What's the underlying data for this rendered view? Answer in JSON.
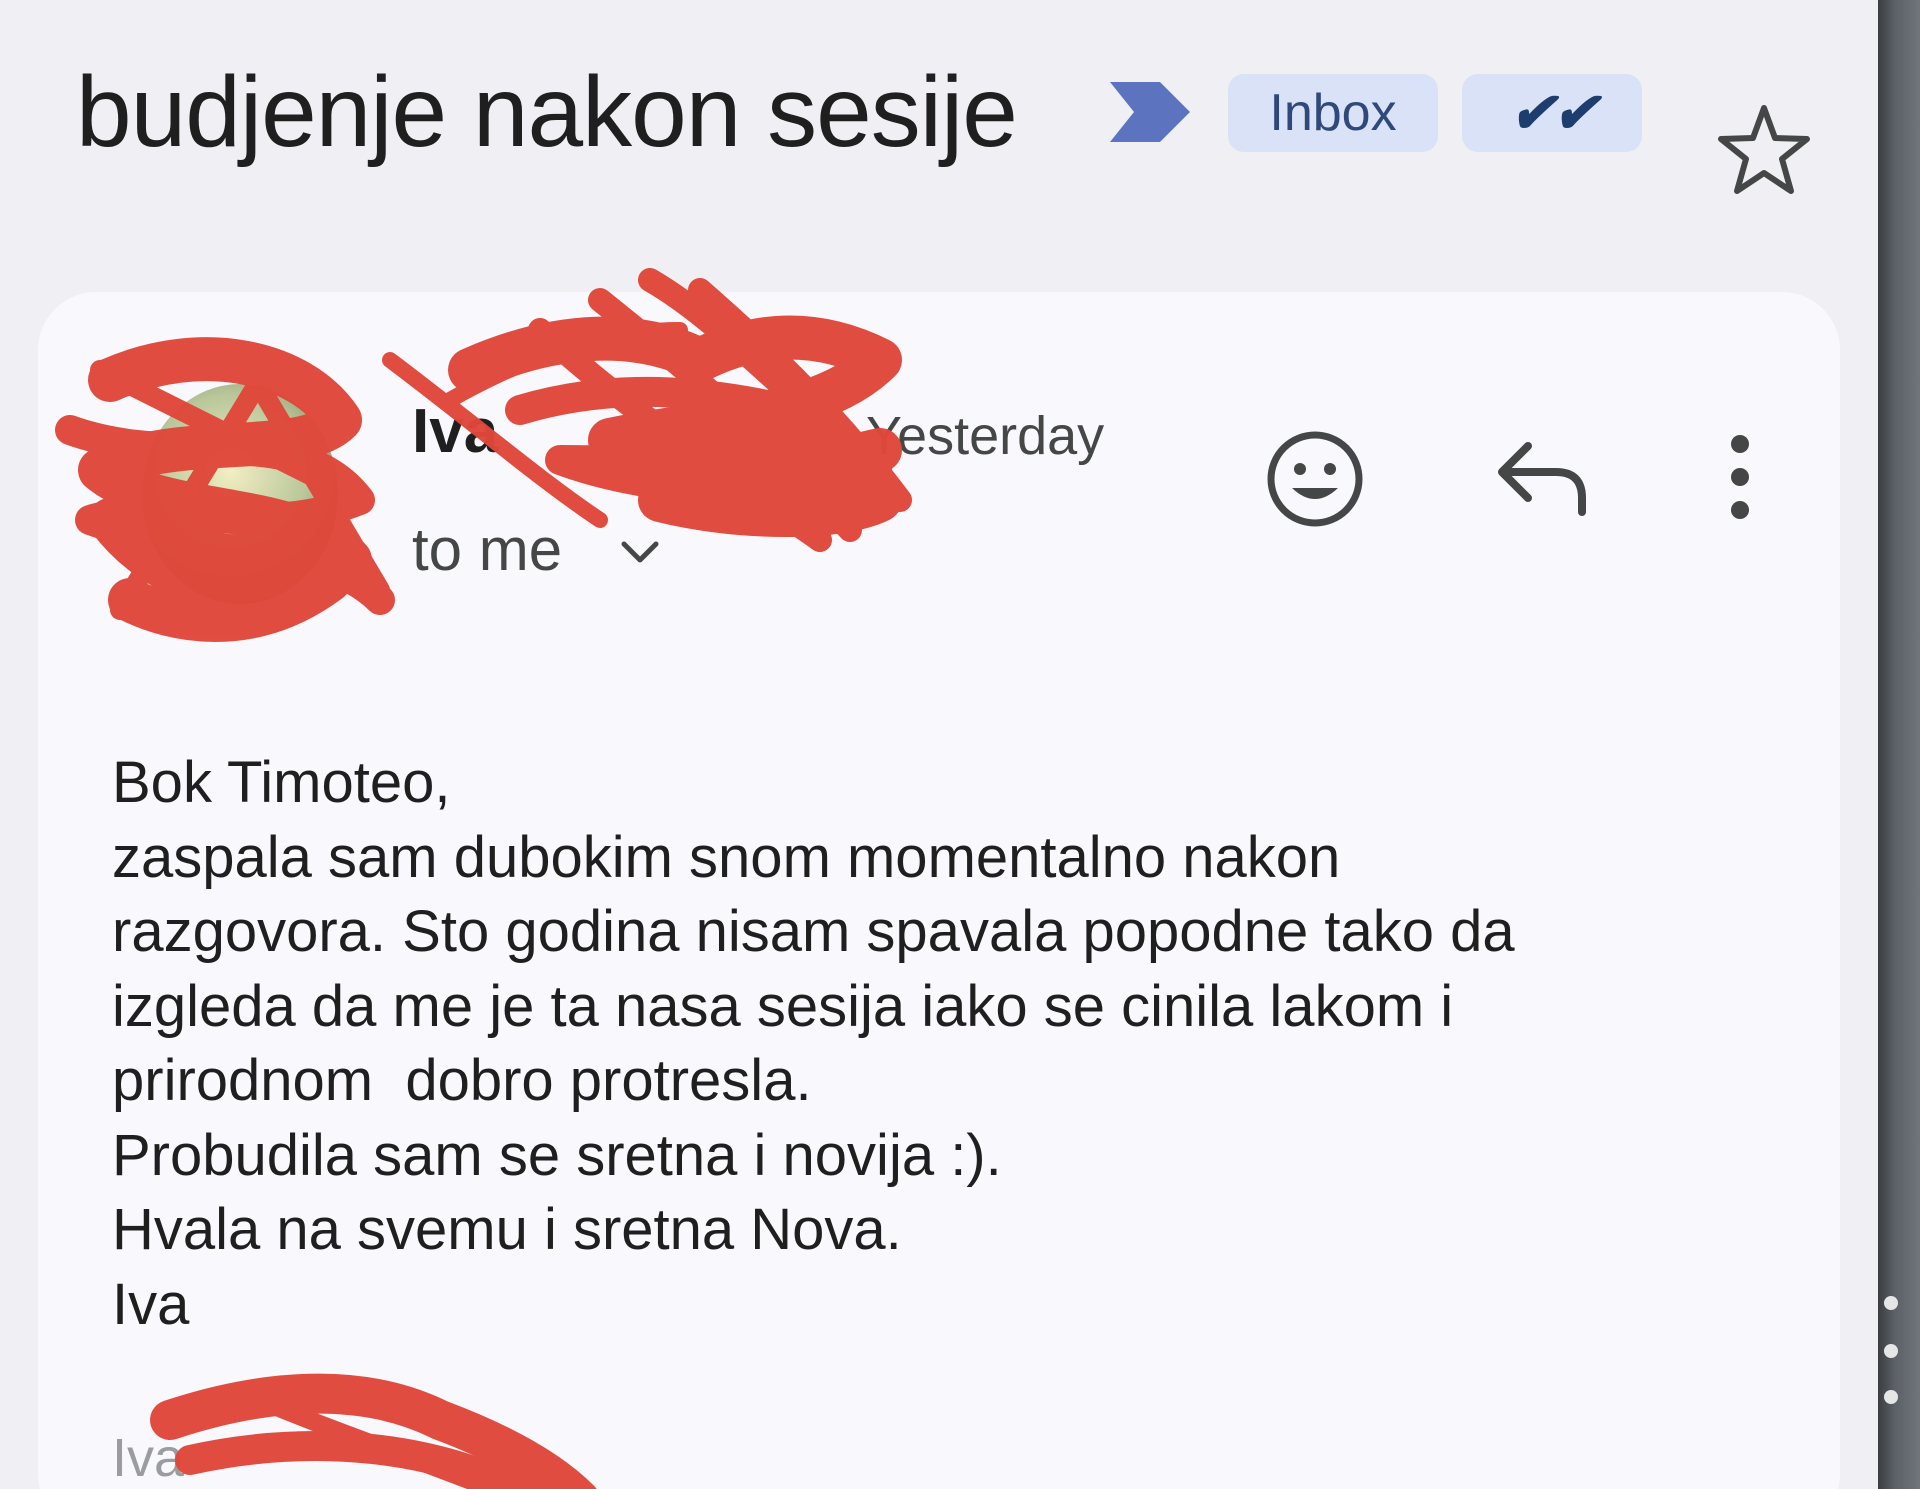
{
  "header": {
    "subject": "budjenje nakon sesije",
    "labels": [
      {
        "text": "Inbox"
      },
      {
        "text": "✔✔"
      }
    ],
    "star_icon": "star-outline-icon",
    "importance_icon": "important-marker-icon"
  },
  "message": {
    "sender_name": "Iva",
    "date": "Yesterday",
    "recipient": "to me",
    "actions": {
      "react_icon": "emoji-icon",
      "reply_icon": "reply-icon",
      "more_icon": "more-vert-icon"
    },
    "body_lines": [
      "Bok Timoteo,",
      "zaspala sam dubokim snom momentalno nakon",
      "razgovora. Sto godina nisam spavala popodne tako da",
      "izgleda da me je ta nasa sesija iako se cinila lakom i",
      "prirodnom  dobro protresla.",
      "Probudila sam se sretna i novija :).",
      "Hvala na svemu i sretna Nova.",
      "Iva"
    ],
    "signature": "Iva"
  },
  "colors": {
    "background": "#efeff4",
    "card": "#f8f8fd",
    "chip_bg": "#d9e2f6",
    "importance_marker": "#5c74c0",
    "redaction": "#e0483a"
  }
}
